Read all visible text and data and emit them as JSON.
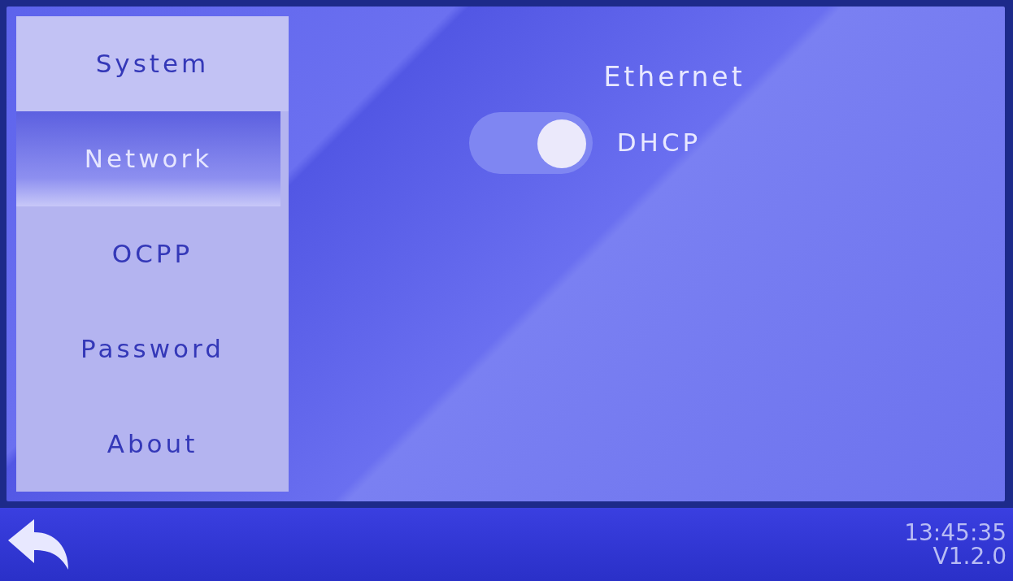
{
  "sidebar": {
    "items": [
      {
        "label": "System",
        "selected": false
      },
      {
        "label": "Network",
        "selected": true
      },
      {
        "label": "OCPP",
        "selected": false
      },
      {
        "label": "Password",
        "selected": false
      },
      {
        "label": "About",
        "selected": false
      }
    ]
  },
  "panel": {
    "title": "Ethernet",
    "settings": [
      {
        "kind": "toggle",
        "label": "DHCP",
        "on": true
      }
    ]
  },
  "status_bar": {
    "time": "13:45:35",
    "version": "V1.2.0"
  }
}
